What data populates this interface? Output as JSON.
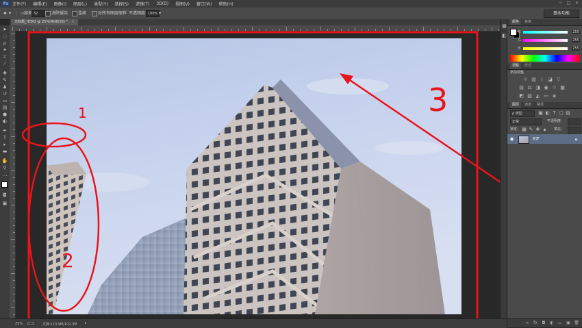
{
  "app": {
    "logo": "Ps"
  },
  "menu": [
    "文件(F)",
    "编辑(E)",
    "图像(I)",
    "图层(L)",
    "类型(Y)",
    "选择(S)",
    "滤镜(T)",
    "3D(D)",
    "视图(V)",
    "窗口(W)",
    "帮助(H)"
  ],
  "window_controls": {
    "minimize": "─",
    "maximize": "□",
    "close": "✕"
  },
  "options_bar": {
    "size_label": "容差:",
    "size_value": "32",
    "antialias_label": "消除锯齿",
    "contiguous_label": "连续",
    "sample_all_label": "对所有图层取样",
    "opacity_label": "不透明度:",
    "opacity_value": "100%",
    "workspace": "基本功能"
  },
  "document": {
    "tab_title": "无标题_HDR2 @ 25%(RGB/16) *",
    "tab_close": "×"
  },
  "statusbar": {
    "zoom": "25%",
    "doc_info": "文档:113.9M/102.3M"
  },
  "annotations": {
    "label_1": "1",
    "label_2": "2",
    "label_3": "3",
    "color": "#e8141b"
  },
  "panels": {
    "color_tabs": [
      "颜色",
      "色板"
    ],
    "channels": [
      {
        "label": "R",
        "value": "255"
      },
      {
        "label": "G",
        "value": "255"
      },
      {
        "label": "B",
        "value": "255"
      }
    ],
    "adjust_tabs": [
      "调整",
      "样式"
    ],
    "adjust_title": "添加调整",
    "layers_tabs": [
      "图层",
      "通道",
      "路径"
    ],
    "kind_label": "ρ 类型",
    "blend_mode": "正常",
    "opacity_label": "不透明度:",
    "lock_label": "锁定:",
    "fill_label": "填充:",
    "layer_name": "背景"
  }
}
